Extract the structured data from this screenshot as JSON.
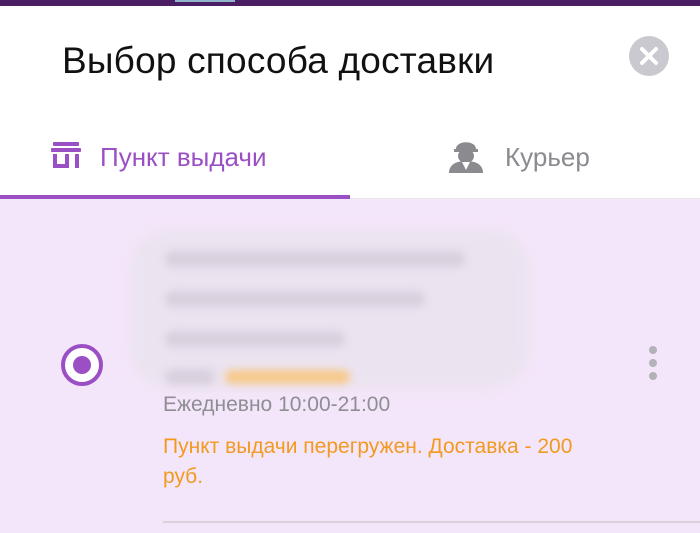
{
  "modal": {
    "title": "Выбор способа доставки"
  },
  "tabs": [
    {
      "label": "Пункт выдачи",
      "icon": "store-icon",
      "active": true
    },
    {
      "label": "Курьер",
      "icon": "courier-icon",
      "active": false
    }
  ],
  "pickup_point": {
    "selected": true,
    "hours": "Ежедневно 10:00-21:00",
    "warning": "Пункт выдачи перегружен. Доставка - 200 руб."
  },
  "colors": {
    "accent": "#9b4fc4",
    "warning": "#f29a1f",
    "selected_bg": "#f4e6fa",
    "top_bar": "#4b1e63"
  }
}
